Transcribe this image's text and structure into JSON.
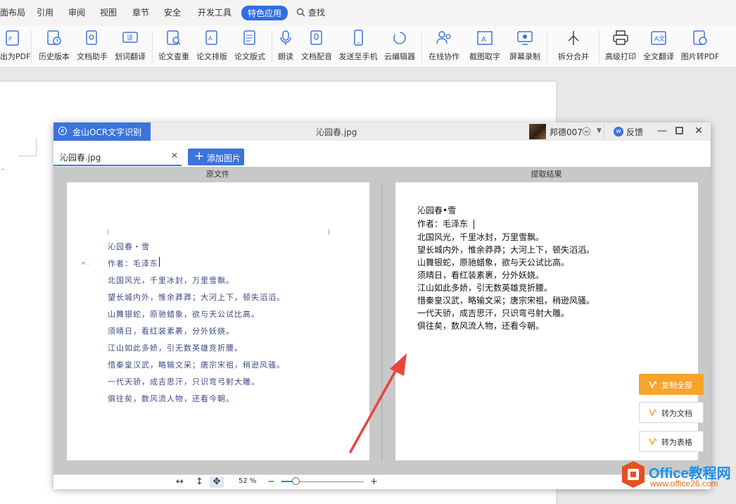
{
  "menubar": {
    "items": [
      "面布局",
      "引用",
      "审阅",
      "视图",
      "章节",
      "安全",
      "开发工具",
      "特色应用"
    ],
    "search_label": "查找"
  },
  "ribbon": {
    "buttons": [
      "出为PDF",
      "历史版本",
      "文档助手",
      "划词翻译",
      "论文查重",
      "论文排版",
      "论文版式",
      "朗读",
      "文档配音",
      "发送至手机",
      "云编辑器",
      "在线协作",
      "截图取字",
      "屏幕录制",
      "拆分合并",
      "高级打印",
      "全文翻译",
      "图片转PDF"
    ]
  },
  "ocr": {
    "app_name": "金山OCR文字识别",
    "window_title": "沁园春.jpg",
    "user_name": "邦德007",
    "feedback_label": "反馈",
    "tab_filename": "沁园春.jpg",
    "add_image_label": "添加图片",
    "left_header": "原文件",
    "right_header": "提取结果",
    "source_lines": [
      "沁园春・雪",
      "作者：毛泽东",
      "北国风光，千里冰封，万里雪飘。",
      "望长城内外，惟余莽莽；大河上下，顿失滔滔。",
      "山舞银蛇，原驰蜡象，欲与天公试比高。",
      "须晴日，看红装素裹，分外妖娆。",
      "江山如此多娇，引无数英雄竞折腰。",
      "惜秦皇汉武，略输文采；唐宗宋祖，稍逊风骚。",
      "一代天骄，成吉思汗，只识弯弓射大雕。",
      "俱往矣，数风流人物，还看今朝。"
    ],
    "result_lines": [
      "沁园春•雪",
      "作者：毛泽东",
      "北国风光，千里冰封，万里雪飘。",
      "望长城内外，惟余莽莽；大河上下，顿失滔滔。",
      "山舞银蛇，原驰蜡象，欲与天公试比高。",
      "须晴日，看红装素裹，分外妖娆。",
      "江山如此多娇，引无数英雄竞折腰。",
      "惜秦皇汉武，略输文采；唐宗宋祖，稍逊风骚。",
      "一代天骄，成吉思汗，只识弯弓射大雕。",
      "俱往矣，数风流人物，还看今朝。"
    ],
    "actions": {
      "copy_all": "复制全部",
      "to_doc": "转为文档",
      "to_table": "转为表格"
    },
    "zoom_label": "52 %",
    "zoom_fraction": 0.17
  },
  "watermark": {
    "title": "Office教程网",
    "url": "www.office26.com"
  },
  "colors": {
    "accent": "#3c74dc",
    "copy_button": "#f6a42c",
    "arrow": "#e8453c",
    "watermark_blue": "#1e90e6",
    "watermark_orange": "#e56c1e"
  }
}
